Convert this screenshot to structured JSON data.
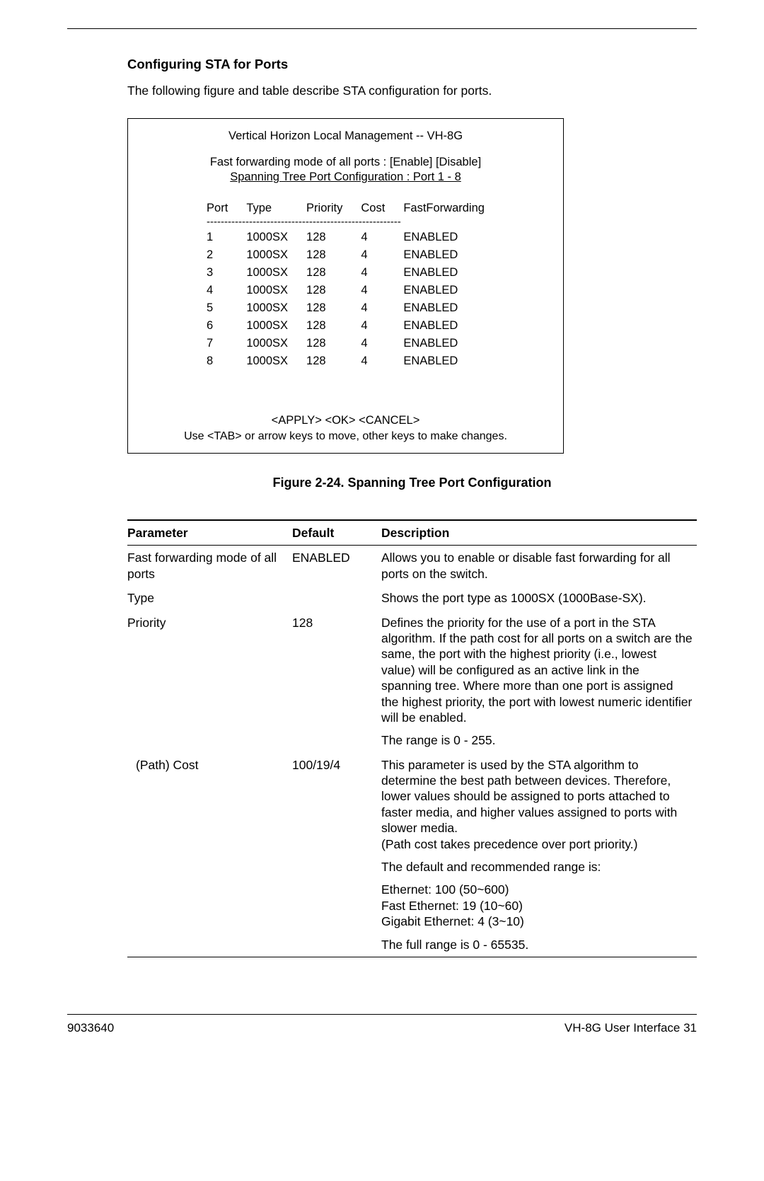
{
  "section_title": "Configuring STA for Ports",
  "intro_text": "The following figure and table describe STA configuration for ports.",
  "terminal": {
    "header": "Vertical Horizon Local Management -- VH-8G",
    "line1": "Fast forwarding mode of all ports : [Enable]   [Disable]",
    "line2": "Spanning Tree Port Configuration : Port  1 - 8",
    "columns": {
      "c1": "Port",
      "c2": "Type",
      "c3": "Priority",
      "c4": "Cost",
      "c5": "FastForwarding"
    },
    "dashes": "-------------------------------------------------------",
    "rows": [
      {
        "port": "1",
        "type": "1000SX",
        "priority": "128",
        "cost": "4",
        "ff": "ENABLED"
      },
      {
        "port": "2",
        "type": "1000SX",
        "priority": "128",
        "cost": "4",
        "ff": "ENABLED"
      },
      {
        "port": "3",
        "type": "1000SX",
        "priority": "128",
        "cost": "4",
        "ff": "ENABLED"
      },
      {
        "port": "4",
        "type": "1000SX",
        "priority": "128",
        "cost": "4",
        "ff": "ENABLED"
      },
      {
        "port": "5",
        "type": "1000SX",
        "priority": "128",
        "cost": "4",
        "ff": "ENABLED"
      },
      {
        "port": "6",
        "type": "1000SX",
        "priority": "128",
        "cost": "4",
        "ff": "ENABLED"
      },
      {
        "port": "7",
        "type": "1000SX",
        "priority": "128",
        "cost": "4",
        "ff": "ENABLED"
      },
      {
        "port": "8",
        "type": "1000SX",
        "priority": "128",
        "cost": "4",
        "ff": "ENABLED"
      }
    ],
    "actions": "<APPLY>      <OK>       <CANCEL>",
    "hint": "Use <TAB> or arrow keys to move, other keys to make changes."
  },
  "figure_caption": "Figure 2-24.  Spanning Tree Port Configuration",
  "param_table": {
    "headers": {
      "h1": "Parameter",
      "h2": "Default",
      "h3": "Description"
    },
    "rows": [
      {
        "param": "Fast forwarding mode of all ports",
        "default": "ENABLED",
        "desc": [
          "Allows you to enable or disable fast forwarding for all ports on the switch."
        ]
      },
      {
        "param": "Type",
        "default": "",
        "desc": [
          "Shows the port type as 1000SX (1000Base-SX)."
        ]
      },
      {
        "param": "Priority",
        "default": "128",
        "desc": [
          "Defines the priority for the use of a port in the STA algorithm. If the path cost for all ports on a switch are the same, the port with the highest priority (i.e., lowest value) will be configured as an active link in the spanning tree. Where more than one port is assigned the highest priority, the port with lowest numeric identifier will be enabled.",
          "The range is 0 - 255."
        ]
      },
      {
        "param": "(Path) Cost",
        "default": "100/19/4",
        "desc": [
          "This parameter is used by the STA algorithm to determine the best path between devices. Therefore, lower values should be assigned to ports attached to faster media, and higher values assigned to ports with slower media.\n(Path cost takes precedence over port priority.)",
          "The default and recommended range is:",
          "Ethernet: 100 (50~600)\nFast Ethernet: 19 (10~60)\nGigabit Ethernet: 4 (3~10)",
          "The full range is 0 - 65535."
        ]
      }
    ]
  },
  "footer": {
    "left": "9033640",
    "right": "VH-8G User Interface  31"
  }
}
